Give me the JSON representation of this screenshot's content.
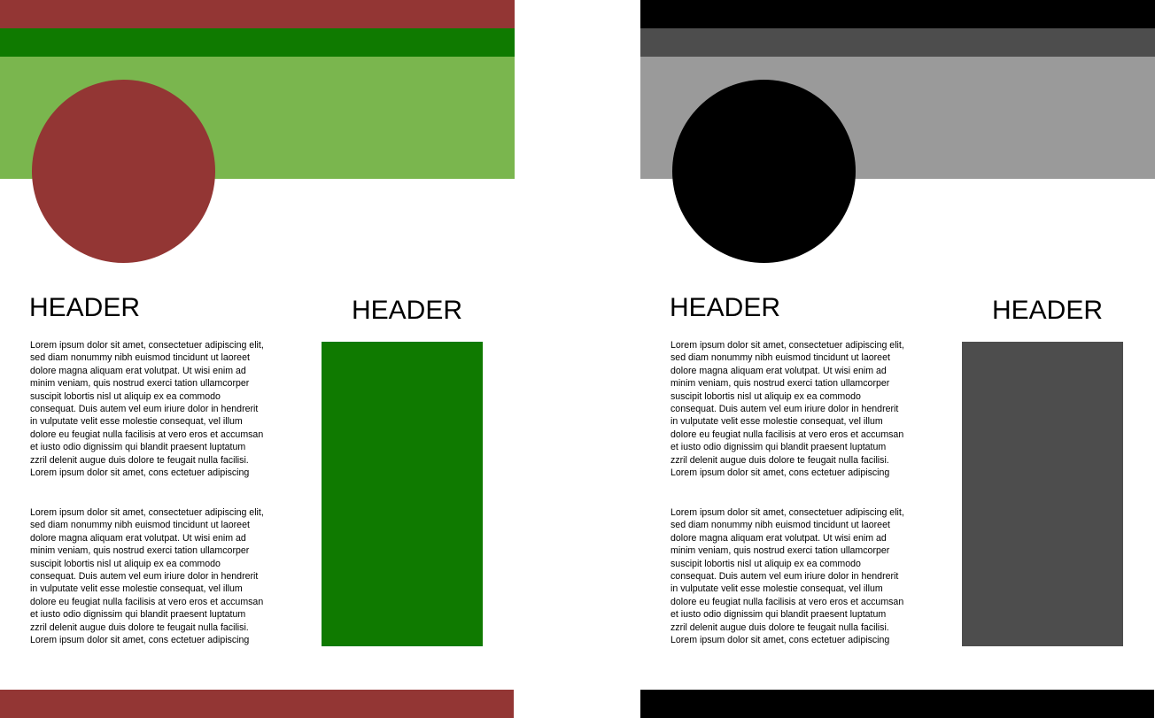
{
  "panels": [
    {
      "name": "color",
      "header_left": "HEADER",
      "header_right": "HEADER",
      "paragraph_1": "Lorem ipsum dolor sit amet, consectetuer adipiscing elit,\nsed diam nonummy nibh euismod tincidunt ut laoreet\ndolore magna aliquam erat volutpat. Ut wisi enim ad\nminim veniam, quis nostrud exerci tation ullamcorper\nsuscipit lobortis nisl ut aliquip ex ea commodo\nconsequat. Duis autem vel eum iriure dolor in hendrerit\nin vulputate velit esse molestie consequat, vel illum\ndolore eu feugiat nulla facilisis at vero eros et accumsan\net iusto odio dignissim qui blandit praesent luptatum\nzzril delenit augue duis dolore te feugait nulla facilisi.\nLorem ipsum dolor sit amet, cons ectetuer adipiscing",
      "paragraph_2": "Lorem ipsum dolor sit amet, consectetuer adipiscing elit,\nsed diam nonummy nibh euismod tincidunt ut laoreet\ndolore magna aliquam erat volutpat. Ut wisi enim ad\nminim veniam, quis nostrud exerci tation ullamcorper\nsuscipit lobortis nisl ut aliquip ex ea commodo\nconsequat. Duis autem vel eum iriure dolor in hendrerit\nin vulputate velit esse molestie consequat, vel illum\ndolore eu feugiat nulla facilisis at vero eros et accumsan\net iusto odio dignissim qui blandit praesent luptatum\nzzril delenit augue duis dolore te feugait nulla facilisi.\nLorem ipsum dolor sit amet, cons ectetuer adipiscing",
      "colors": {
        "bar_top": "#933634",
        "bar_mid": "#0f7a00",
        "band": "#7ab64e",
        "circle": "#933634",
        "rect": "#0f7a00",
        "bar_bottom": "#933634"
      }
    },
    {
      "name": "grayscale",
      "header_left": "HEADER",
      "header_right": "HEADER",
      "paragraph_1": "Lorem ipsum dolor sit amet, consectetuer adipiscing elit,\nsed diam nonummy nibh euismod tincidunt ut laoreet\ndolore magna aliquam erat volutpat. Ut wisi enim ad\nminim veniam, quis nostrud exerci tation ullamcorper\nsuscipit lobortis nisl ut aliquip ex ea commodo\nconsequat. Duis autem vel eum iriure dolor in hendrerit\nin vulputate velit esse molestie consequat, vel illum\ndolore eu feugiat nulla facilisis at vero eros et accumsan\net iusto odio dignissim qui blandit praesent luptatum\nzzril delenit augue duis dolore te feugait nulla facilisi.\nLorem ipsum dolor sit amet, cons ectetuer adipiscing",
      "paragraph_2": "Lorem ipsum dolor sit amet, consectetuer adipiscing elit,\nsed diam nonummy nibh euismod tincidunt ut laoreet\ndolore magna aliquam erat volutpat. Ut wisi enim ad\nminim veniam, quis nostrud exerci tation ullamcorper\nsuscipit lobortis nisl ut aliquip ex ea commodo\nconsequat. Duis autem vel eum iriure dolor in hendrerit\nin vulputate velit esse molestie consequat, vel illum\ndolore eu feugiat nulla facilisis at vero eros et accumsan\net iusto odio dignissim qui blandit praesent luptatum\nzzril delenit augue duis dolore te feugait nulla facilisi.\nLorem ipsum dolor sit amet, cons ectetuer adipiscing",
      "colors": {
        "bar_top": "#000000",
        "bar_mid": "#4d4d4d",
        "band": "#9a9a9a",
        "circle": "#000000",
        "rect": "#4d4d4d",
        "bar_bottom": "#000000"
      }
    }
  ]
}
